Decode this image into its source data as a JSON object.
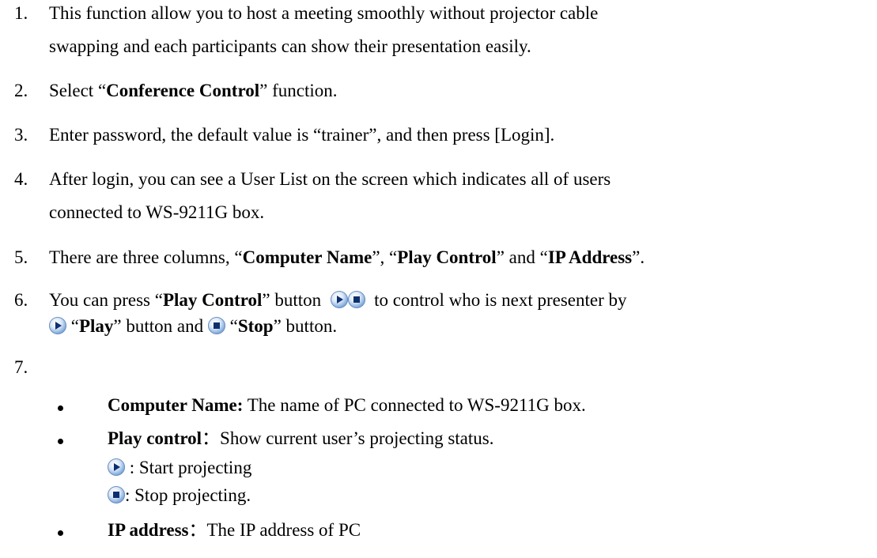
{
  "items": [
    {
      "n": "1.",
      "l1": "This function allow you to host a meeting smoothly without projector cable",
      "l2": "swapping and each participants can show their presentation easily."
    },
    {
      "n": "2.",
      "pre": "Select “",
      "bold": "Conference Control",
      "post": "” function."
    },
    {
      "n": "3.",
      "text": "Enter password, the default value is “trainer”, and then press [Login]."
    },
    {
      "n": "4.",
      "l1": "After login, you can see a User List on the screen which indicates all of users",
      "l2": "connected to WS-9211G box."
    },
    {
      "n": "5.",
      "a": "There are three columns, “",
      "b1": "Computer Name",
      "c": "”, “",
      "b2": "Play Control",
      "d": "” and “",
      "b3": "IP Address",
      "e": "”."
    },
    {
      "n": "6.",
      "a": "You can press “",
      "b1": "Play Control",
      "c": "” button",
      "d": "to control who is next presenter by",
      "e": "“",
      "b2": "Play",
      "f": "” button and",
      "g": "“",
      "b3": "Stop",
      "h": "” button."
    },
    {
      "n": "7."
    }
  ],
  "bullets": [
    {
      "bold": "Computer Name:",
      "text": " The name of PC connected to WS-9211G box."
    },
    {
      "bold": "Play control",
      "text": "：Show current user’s projecting status."
    },
    {
      "bold": "IP address",
      "text": "：The IP address of PC"
    }
  ],
  "legend": [
    {
      "icon": "play-icon",
      "text": " :   Start projecting"
    },
    {
      "icon": "stop-icon",
      "text": ":   Stop projecting."
    }
  ]
}
